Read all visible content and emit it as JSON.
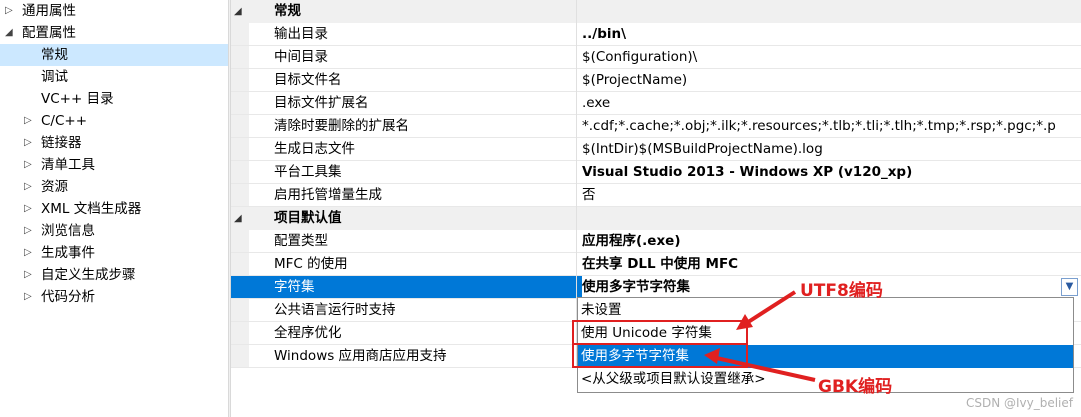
{
  "tree": {
    "items": [
      {
        "label": "通用属性",
        "caret": "▷",
        "depth": 0
      },
      {
        "label": "配置属性",
        "caret": "◢",
        "depth": 0
      },
      {
        "label": "常规",
        "caret": "",
        "depth": 1,
        "selected": true
      },
      {
        "label": "调试",
        "caret": "",
        "depth": 1
      },
      {
        "label": "VC++ 目录",
        "caret": "",
        "depth": 1
      },
      {
        "label": "C/C++",
        "caret": "▷",
        "depth": 1
      },
      {
        "label": "链接器",
        "caret": "▷",
        "depth": 1
      },
      {
        "label": "清单工具",
        "caret": "▷",
        "depth": 1
      },
      {
        "label": "资源",
        "caret": "▷",
        "depth": 1
      },
      {
        "label": "XML 文档生成器",
        "caret": "▷",
        "depth": 1
      },
      {
        "label": "浏览信息",
        "caret": "▷",
        "depth": 1
      },
      {
        "label": "生成事件",
        "caret": "▷",
        "depth": 1
      },
      {
        "label": "自定义生成步骤",
        "caret": "▷",
        "depth": 1
      },
      {
        "label": "代码分析",
        "caret": "▷",
        "depth": 1
      }
    ]
  },
  "grid": {
    "categories": [
      {
        "label": "常规",
        "caret": "◢",
        "rows": [
          {
            "name": "输出目录",
            "value": "../bin\\",
            "bold": true
          },
          {
            "name": "中间目录",
            "value": "$(Configuration)\\",
            "bold": false
          },
          {
            "name": "目标文件名",
            "value": "$(ProjectName)",
            "bold": false
          },
          {
            "name": "目标文件扩展名",
            "value": ".exe",
            "bold": false
          },
          {
            "name": "清除时要删除的扩展名",
            "value": "*.cdf;*.cache;*.obj;*.ilk;*.resources;*.tlb;*.tli;*.tlh;*.tmp;*.rsp;*.pgc;*.p",
            "bold": false
          },
          {
            "name": "生成日志文件",
            "value": "$(IntDir)$(MSBuildProjectName).log",
            "bold": false
          },
          {
            "name": "平台工具集",
            "value": "Visual Studio 2013 - Windows XP (v120_xp)",
            "bold": true
          },
          {
            "name": "启用托管增量生成",
            "value": "否",
            "bold": false
          }
        ]
      },
      {
        "label": "项目默认值",
        "caret": "◢",
        "rows": [
          {
            "name": "配置类型",
            "value": "应用程序(.exe)",
            "bold": true
          },
          {
            "name": "MFC 的使用",
            "value": "在共享 DLL 中使用 MFC",
            "bold": true
          },
          {
            "name": "字符集",
            "value": "使用多字节字符集",
            "bold": true,
            "selected": true
          },
          {
            "name": "公共语言运行时支持",
            "value": "",
            "bold": false
          },
          {
            "name": "全程序优化",
            "value": "",
            "bold": false
          },
          {
            "name": "Windows 应用商店应用支持",
            "value": "",
            "bold": false
          }
        ]
      }
    ]
  },
  "dropdown": {
    "button_icon": "chevron-down-icon",
    "options": [
      {
        "label": "未设置"
      },
      {
        "label": "使用 Unicode 字符集"
      },
      {
        "label": "使用多字节字符集",
        "highlight": true
      },
      {
        "label": "<从父级或项目默认设置继承>"
      }
    ]
  },
  "annotations": {
    "utf8_label": "UTF8编码",
    "gbk_label": "GBK编码",
    "color": "#e02020"
  },
  "watermark": "CSDN @Ivy_belief"
}
